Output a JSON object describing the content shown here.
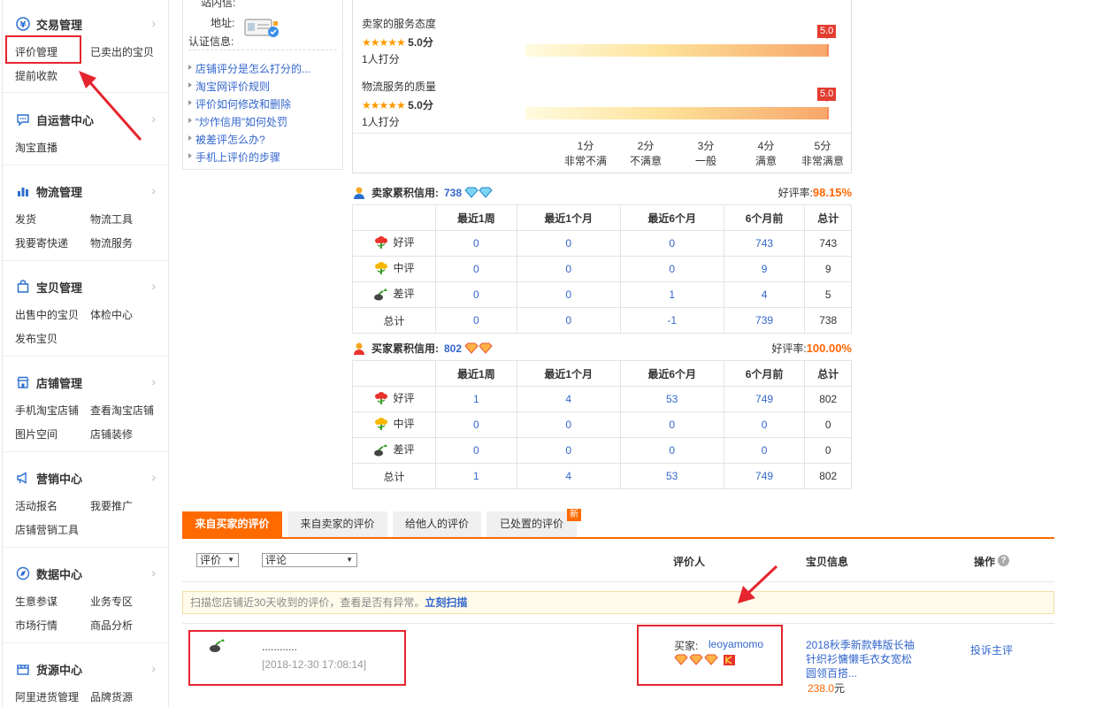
{
  "sidebar": {
    "sections": [
      {
        "title": "交易管理",
        "links": [
          "评价管理",
          "已卖出的宝贝",
          "提前收款"
        ]
      },
      {
        "title": "自运营中心",
        "links": [
          "淘宝直播"
        ]
      },
      {
        "title": "物流管理",
        "links": [
          "发货",
          "物流工具",
          "我要寄快递",
          "物流服务"
        ]
      },
      {
        "title": "宝贝管理",
        "links": [
          "出售中的宝贝",
          "体检中心",
          "发布宝贝"
        ]
      },
      {
        "title": "店铺管理",
        "links": [
          "手机淘宝店铺",
          "查看淘宝店铺",
          "图片空间",
          "店铺装修"
        ]
      },
      {
        "title": "营销中心",
        "links": [
          "活动报名",
          "我要推广",
          "店铺营销工具"
        ]
      },
      {
        "title": "数据中心",
        "links": [
          "生意参谋",
          "业务专区",
          "市场行情",
          "商品分析"
        ]
      },
      {
        "title": "货源中心",
        "links": [
          "阿里进货管理",
          "品牌货源"
        ]
      }
    ]
  },
  "info": {
    "top_cut": "站内信:",
    "address_label": "地址:",
    "auth_label": "认证信息:",
    "faq": [
      "店铺评分是怎么打分的...",
      "淘宝网评价规则",
      "评价如何修改和删除",
      "“炒作信用”如何处罚",
      "被差评怎么办?",
      "手机上评价的步骤"
    ]
  },
  "dsr": {
    "items": [
      {
        "label": "卖家的服务态度",
        "stars": "★★★★★",
        "score": "5.0分",
        "count": "1人打分",
        "flag": "5.0"
      },
      {
        "label": "物流服务的质量",
        "stars": "★★★★★",
        "score": "5.0分",
        "count": "1人打分",
        "flag": "5.0"
      }
    ],
    "scale": [
      {
        "n": "1分",
        "t": "非常不满"
      },
      {
        "n": "2分",
        "t": "不满意"
      },
      {
        "n": "3分",
        "t": "一般"
      },
      {
        "n": "4分",
        "t": "满意"
      },
      {
        "n": "5分",
        "t": "非常满意"
      }
    ]
  },
  "seller_credit": {
    "label": "卖家累积信用:",
    "value": "738",
    "rate_label": "好评率:",
    "rate": "98.15%",
    "headers": [
      "最近1周",
      "最近1个月",
      "最近6个月",
      "6个月前",
      "总计"
    ],
    "rows": [
      {
        "label": "好评",
        "values": [
          "0",
          "0",
          "0",
          "743",
          "743"
        ]
      },
      {
        "label": "中评",
        "values": [
          "0",
          "0",
          "0",
          "9",
          "9"
        ]
      },
      {
        "label": "差评",
        "values": [
          "0",
          "0",
          "1",
          "4",
          "5"
        ]
      },
      {
        "label": "总计",
        "values": [
          "0",
          "0",
          "-1",
          "739",
          "738"
        ]
      }
    ]
  },
  "buyer_credit": {
    "label": "买家累积信用:",
    "value": "802",
    "rate_label": "好评率:",
    "rate": "100.00%",
    "headers": [
      "最近1周",
      "最近1个月",
      "最近6个月",
      "6个月前",
      "总计"
    ],
    "rows": [
      {
        "label": "好评",
        "values": [
          "1",
          "4",
          "53",
          "749",
          "802"
        ]
      },
      {
        "label": "中评",
        "values": [
          "0",
          "0",
          "0",
          "0",
          "0"
        ]
      },
      {
        "label": "差评",
        "values": [
          "0",
          "0",
          "0",
          "0",
          "0"
        ]
      },
      {
        "label": "总计",
        "values": [
          "1",
          "4",
          "53",
          "749",
          "802"
        ]
      }
    ]
  },
  "tabs": [
    "来自买家的评价",
    "来自卖家的评价",
    "给他人的评价",
    "已处置的评价"
  ],
  "new_badge": "新",
  "filters": {
    "rating": "评价",
    "comment": "评论"
  },
  "columns": {
    "reviewer": "评价人",
    "item": "宝贝信息",
    "action": "操作"
  },
  "notice": {
    "text": "扫描您店铺近30天收到的评价，查看是否有异常。",
    "link": "立刻扫描"
  },
  "review": {
    "content": "............",
    "time": "[2018-12-30 17:08:14]",
    "buyer_label": "买家:",
    "buyer_name": "leoyamomo",
    "item_title": "2018秋季新款韩版长袖针织衫慵懒毛衣女宽松圆领百搭...",
    "price": "238.0",
    "currency": "元",
    "action": "投诉主评"
  },
  "colors": {
    "accent": "#ff6a00",
    "link": "#3366cc",
    "highlight": "#e5252e"
  }
}
